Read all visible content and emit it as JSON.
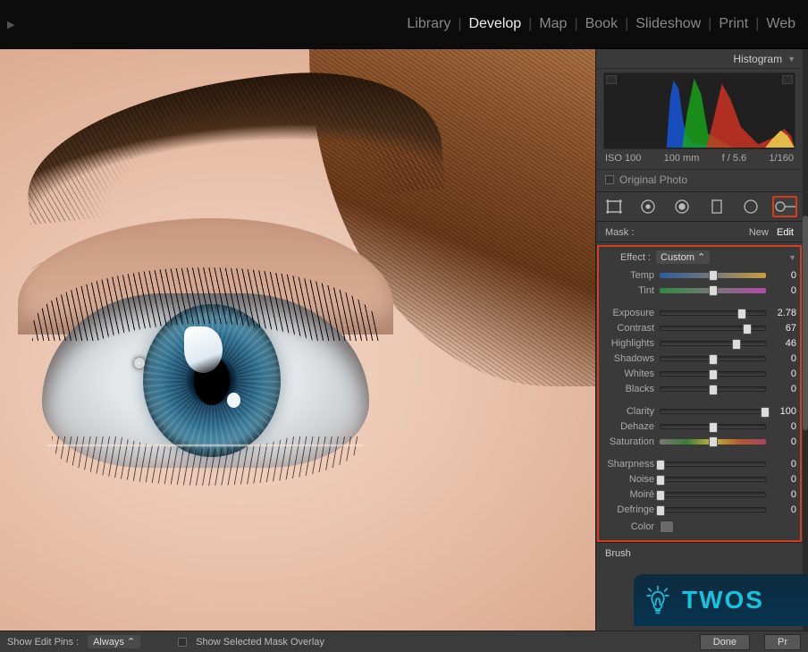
{
  "modules": {
    "library": "Library",
    "develop": "Develop",
    "map": "Map",
    "book": "Book",
    "slideshow": "Slideshow",
    "print": "Print",
    "web": "Web",
    "active": "develop"
  },
  "histogram": {
    "title": "Histogram",
    "iso": "ISO 100",
    "focal": "100 mm",
    "aperture": "f / 5.6",
    "shutter": "1/160",
    "original_label": "Original Photo"
  },
  "mask": {
    "label": "Mask :",
    "new": "New",
    "edit": "Edit"
  },
  "effect": {
    "label": "Effect :",
    "preset": "Custom"
  },
  "sliders": {
    "temp": {
      "label": "Temp",
      "value": 0,
      "pct": 50,
      "track": "temp"
    },
    "tint": {
      "label": "Tint",
      "value": 0,
      "pct": 50,
      "track": "tint"
    },
    "exposure": {
      "label": "Exposure",
      "value": 2.78,
      "pct": 78,
      "track": "plain"
    },
    "contrast": {
      "label": "Contrast",
      "value": 67,
      "pct": 83,
      "track": "plain"
    },
    "highlights": {
      "label": "Highlights",
      "value": 46,
      "pct": 73,
      "track": "plain"
    },
    "shadows": {
      "label": "Shadows",
      "value": 0,
      "pct": 50,
      "track": "plain"
    },
    "whites": {
      "label": "Whites",
      "value": 0,
      "pct": 50,
      "track": "plain"
    },
    "blacks": {
      "label": "Blacks",
      "value": 0,
      "pct": 50,
      "track": "plain"
    },
    "clarity": {
      "label": "Clarity",
      "value": 100,
      "pct": 100,
      "track": "plain"
    },
    "dehaze": {
      "label": "Dehaze",
      "value": 0,
      "pct": 50,
      "track": "plain"
    },
    "saturation": {
      "label": "Saturation",
      "value": 0,
      "pct": 50,
      "track": "sat"
    },
    "sharpness": {
      "label": "Sharpness",
      "value": 0,
      "pct": 0,
      "track": "plain"
    },
    "noise": {
      "label": "Noise",
      "value": 0,
      "pct": 0,
      "track": "plain"
    },
    "moire": {
      "label": "Moiré",
      "value": 0,
      "pct": 0,
      "track": "plain"
    },
    "defringe": {
      "label": "Defringe",
      "value": 0,
      "pct": 0,
      "track": "plain"
    }
  },
  "slider_groups": [
    [
      "temp",
      "tint"
    ],
    [
      "exposure",
      "contrast",
      "highlights",
      "shadows",
      "whites",
      "blacks"
    ],
    [
      "clarity",
      "dehaze",
      "saturation"
    ],
    [
      "sharpness",
      "noise",
      "moire",
      "defringe"
    ]
  ],
  "color": {
    "label": "Color"
  },
  "brush_section": "Brush",
  "bottom": {
    "pins_label": "Show Edit Pins :",
    "pins_value": "Always",
    "maskoverlay": "Show Selected Mask Overlay",
    "done": "Done",
    "pr": "Pr"
  },
  "overlay": {
    "brand": "TWOS"
  }
}
